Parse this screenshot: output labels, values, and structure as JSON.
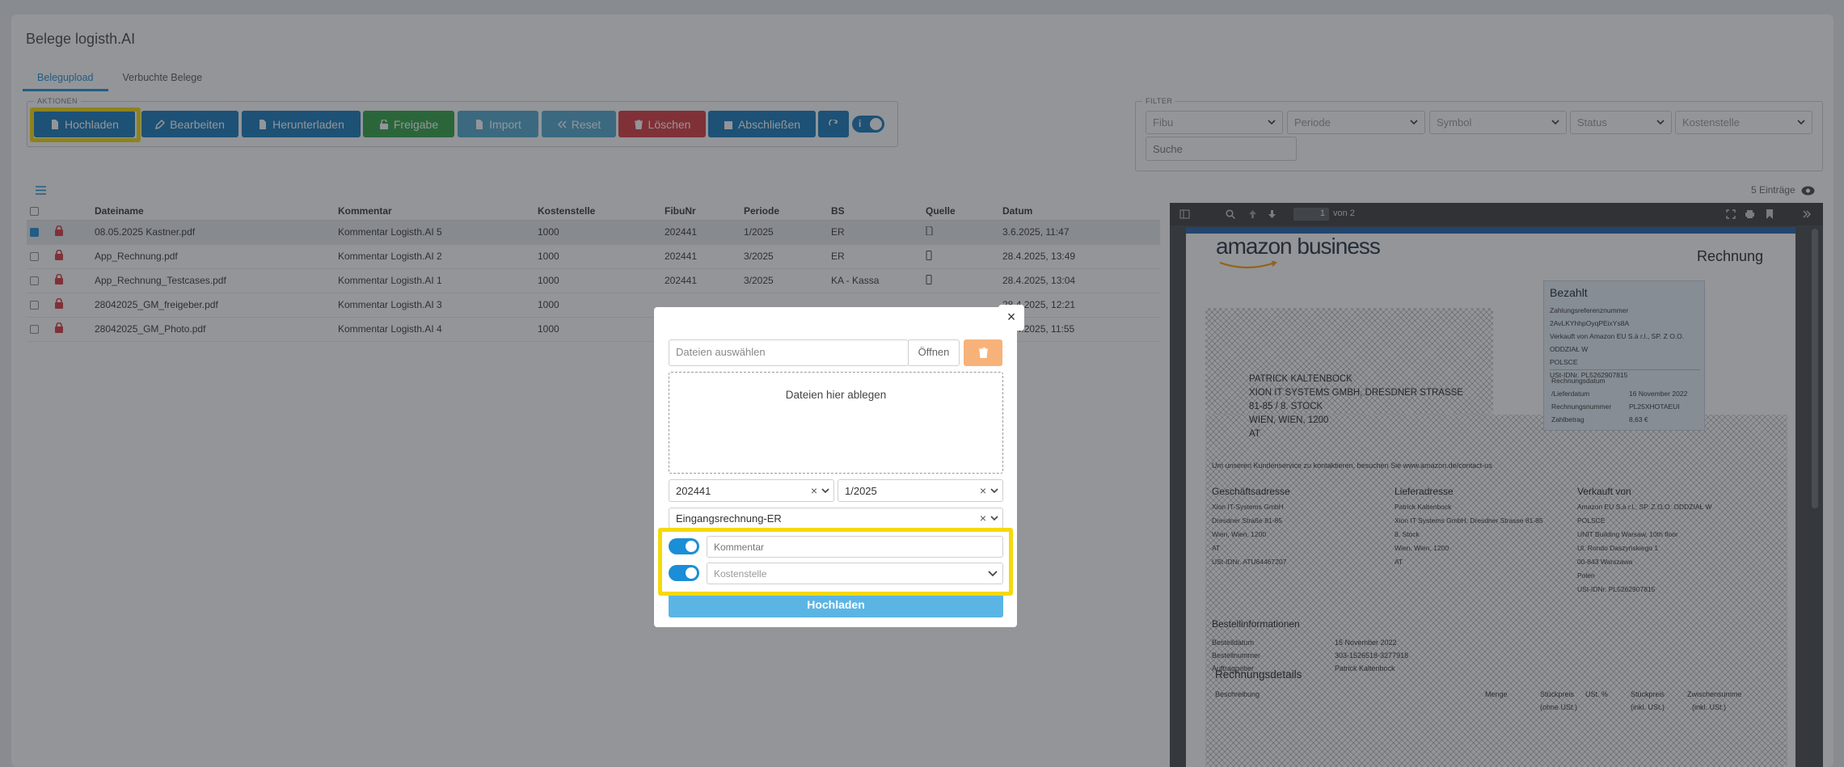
{
  "page": {
    "title": "Belege logisth.AI"
  },
  "tabs": [
    {
      "label": "Belegupload"
    },
    {
      "label": "Verbuchte Belege"
    }
  ],
  "actions": {
    "legend": "AKTIONEN",
    "buttons": [
      "Hochladen",
      "Bearbeiten",
      "Herunterladen",
      "Freigabe",
      "Import",
      "Reset",
      "Löschen",
      "Abschließen"
    ],
    "toggle_label": "i"
  },
  "filter": {
    "legend": "FILTER",
    "selects": [
      "Fibu",
      "Periode",
      "Symbol",
      "Status",
      "Kostenstelle"
    ],
    "search_placeholder": "Suche"
  },
  "table": {
    "entries": "5 Einträge",
    "headers": [
      "Dateiname",
      "Kommentar",
      "Kostenstelle",
      "FibuNr",
      "Periode",
      "BS",
      "Quelle",
      "Datum"
    ],
    "rows": [
      {
        "file": "08.05.2025 Kastner.pdf",
        "comment": "Kommentar Logisth.AI 5",
        "cost": "1000",
        "fibu": "202441",
        "period": "1/2025",
        "bs": "ER",
        "source": "doc",
        "date": "3.6.2025, 11:47",
        "checked": true
      },
      {
        "file": "App_Rechnung.pdf",
        "comment": "Kommentar Logisth.AI 2",
        "cost": "1000",
        "fibu": "202441",
        "period": "3/2025",
        "bs": "ER",
        "source": "phone",
        "date": "28.4.2025, 13:49",
        "checked": false
      },
      {
        "file": "App_Rechnung_Testcases.pdf",
        "comment": "Kommentar Logisth.AI 1",
        "cost": "1000",
        "fibu": "202441",
        "period": "3/2025",
        "bs": "KA - Kassa",
        "source": "phone",
        "date": "28.4.2025, 13:04",
        "checked": false
      },
      {
        "file": "28042025_GM_freigeber.pdf",
        "comment": "Kommentar Logisth.AI 3",
        "cost": "1000",
        "fibu": "",
        "period": "",
        "bs": "",
        "source": "",
        "date": "28.4.2025, 12:21",
        "checked": false
      },
      {
        "file": "28042025_GM_Photo.pdf",
        "comment": "Kommentar Logisth.AI 4",
        "cost": "1000",
        "fibu": "",
        "period": "",
        "bs": "",
        "source": "",
        "date": "28.4.2025, 11:55",
        "checked": false
      }
    ]
  },
  "viewer": {
    "page_input": "1",
    "page_total": "von 2"
  },
  "invoice": {
    "brand": "amazon business",
    "doc_title": "Rechnung",
    "paid_title": "Bezahlt",
    "paid_lines": [
      "Zahlungsreferenznummer 2AvLKYhhpOyqPEixYs8A",
      "Verkauft von Amazon EU S.à r.l., SP. Z O.O. ODDZIAŁ W",
      "POLSCE",
      "USt-IDNr. PL5262907815"
    ],
    "meta": [
      [
        "Rechnungsdatum",
        ""
      ],
      [
        "/Lieferdatum",
        "16 November 2022"
      ],
      [
        "Rechnungsnummer",
        "PL25XHOTAEUI"
      ],
      [
        "Zahlbetrag",
        "8,63 €"
      ]
    ],
    "address": [
      "PATRICK KALTENBOCK",
      "XION IT SYSTEMS GMBH, DRESDNER STRASSE",
      "81-85 / 8. STOCK",
      "WIEN, WIEN, 1200",
      "AT"
    ],
    "contact": "Um unseren Kundenservice zu kontaktieren, besuchen Sie www.amazon.de/contact-us",
    "cols": [
      {
        "h": "Geschäftsadresse",
        "l": [
          "Xion IT-Systems GmbH",
          "Dresdner Straße 81-85",
          "Wien, Wien, 1200",
          "AT",
          "USt-IDNr. ATU64467207"
        ]
      },
      {
        "h": "Lieferadresse",
        "l": [
          "Patrick Kaltenbock",
          "Xion IT Systems GmbH, Dresdner Strasse 81-85",
          "8. Stock",
          "Wien, Wien, 1200",
          "AT"
        ]
      },
      {
        "h": "Verkauft von",
        "l": [
          "Amazon EU S.à r.l., SP. Z O.O. ODDZIAŁ W",
          "POLSCE",
          "UNIT Building Warsaw, 10th floor",
          "Ul. Rondo Daszyńskiego 1",
          "00-843 Warszawa",
          "Polen",
          "USt-IDNr. PL5262907815"
        ]
      }
    ],
    "order_title": "Bestellinformationen",
    "order": [
      [
        "Bestelldatum",
        "15 November 2022"
      ],
      [
        "Bestellnummer",
        "303-1526518-3277918"
      ],
      [
        "Auftraggeber",
        "Patrick Kaltenbock"
      ]
    ],
    "details_title": "Rechnungsdetails",
    "details_headers": [
      "Beschreibung",
      "Menge",
      "Stückpreis",
      "USt. %",
      "Stückpreis",
      "Zwischensumme"
    ],
    "details_sub": [
      "(ohne USt.)",
      "(inkl. USt.)",
      "(inkl. USt.)"
    ]
  },
  "modal": {
    "file_placeholder": "Dateien auswählen",
    "open_label": "Öffnen",
    "drop_label": "Dateien hier ablegen",
    "fibu": "202441",
    "period": "1/2025",
    "type": "Eingangsrechnung-ER",
    "comment_placeholder": "Kommentar",
    "cost_placeholder": "Kostenstelle",
    "submit": "Hochladen",
    "close": "×"
  }
}
